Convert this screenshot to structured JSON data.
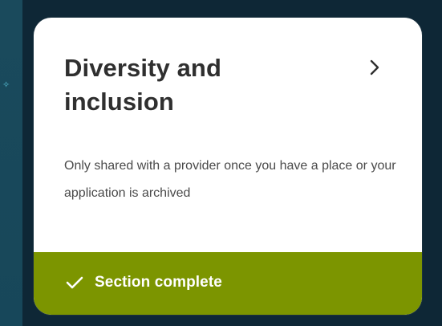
{
  "card": {
    "title": "Diversity and inclusion",
    "description": "Only shared with a provider once you have a place or your application is archived",
    "chevron_icon": "chevron-right-icon",
    "status": {
      "label": "Section complete",
      "icon": "checkmark-icon",
      "color": "#7c9500"
    }
  },
  "colors": {
    "background": "#0e2736",
    "card_background": "#ffffff",
    "title_text": "#2f2f2f",
    "body_text": "#4a4a4a",
    "status_text": "#ffffff"
  }
}
